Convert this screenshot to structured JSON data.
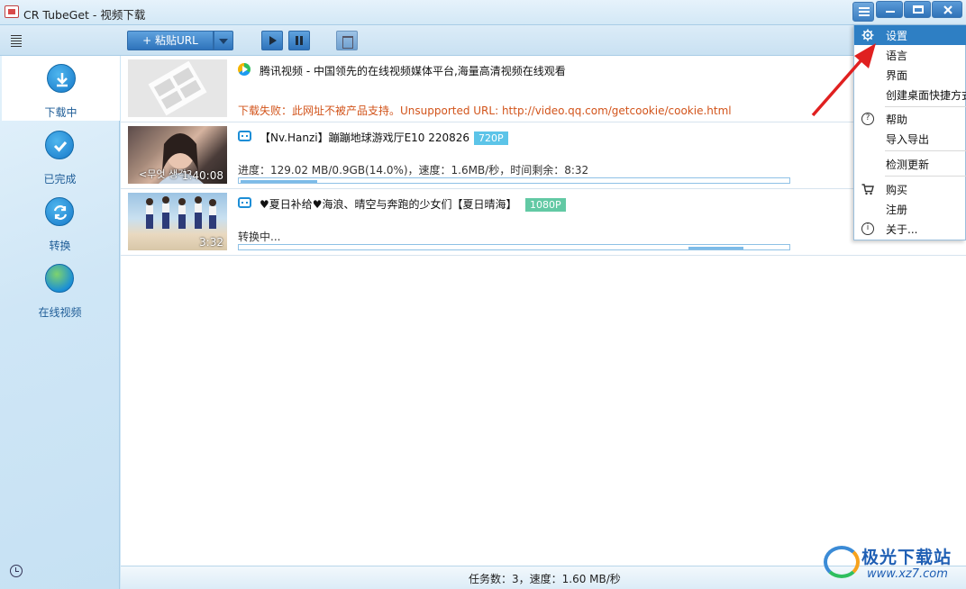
{
  "window": {
    "title": "CR TubeGet - 视频下载"
  },
  "toolbar": {
    "paste_label": "+ 粘贴URL"
  },
  "sidebar": {
    "items": [
      {
        "label": "下载中",
        "icon": "download-icon",
        "active": true
      },
      {
        "label": "已完成",
        "icon": "check-icon"
      },
      {
        "label": "转换",
        "icon": "convert-icon"
      },
      {
        "label": "在线视频",
        "icon": "globe-icon"
      }
    ]
  },
  "downloads": [
    {
      "title": "腾讯视频 - 中国领先的在线视频媒体平台,海量高清视频在线观看",
      "status": "下载失败：此网址不被产品支持。Unsupported URL: http://video.qq.com/getcookie/cookie.html",
      "source_icon": "tencent-video-icon"
    },
    {
      "title": "【Nv.Hanzi】蹦蹦地球游戏厅E10 220826",
      "quality": "720P",
      "duration": "1:40:08",
      "thumb_caption": "<무엇 생각?",
      "status": "进度：129.02 MB/0.9GB(14.0%)，速度：1.6MB/秒，时间剩余：8:32",
      "progress": 0.14,
      "source_icon": "bilibili-icon"
    },
    {
      "title": "♥夏日补给♥海浪、晴空与奔跑的少女们【夏日晴海】",
      "quality": "1080P",
      "duration": "3:32",
      "status": "转换中...",
      "progress_segment": [
        0.82,
        0.92
      ],
      "source_icon": "bilibili-icon"
    }
  ],
  "statusbar": {
    "text": "任务数：3，速度：1.60 MB/秒"
  },
  "menu": {
    "items": [
      {
        "label": "设置",
        "icon": "gear-icon",
        "highlighted": true
      },
      {
        "label": "语言"
      },
      {
        "label": "界面"
      },
      {
        "label": "创建桌面快捷方式"
      },
      {
        "label": "帮助",
        "icon": "help-icon"
      },
      {
        "label": "导入导出"
      },
      {
        "label": "检测更新"
      },
      {
        "label": "购买",
        "icon": "cart-icon"
      },
      {
        "label": "注册"
      },
      {
        "label": "关于...",
        "icon": "info-icon"
      }
    ]
  },
  "watermark": {
    "brand": "极光下载站",
    "url": "www.xz7.com"
  },
  "colors": {
    "accent": "#2e7fc4",
    "error": "#d2541b",
    "badge_720": "#5cc4e8",
    "badge_1080": "#62c9a4"
  }
}
